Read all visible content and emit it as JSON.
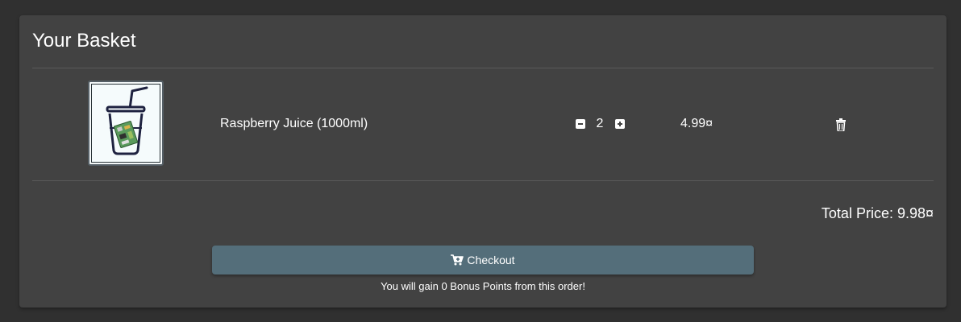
{
  "basket": {
    "title": "Your Basket",
    "items": [
      {
        "image_icon": "juice-cup-icon",
        "name": "Raspberry Juice (1000ml)",
        "quantity": "2",
        "price": "4.99¤"
      }
    ],
    "total_price": "Total Price: 9.98¤",
    "checkout_label": "Checkout",
    "bonus_message": "You will gain 0 Bonus Points from this order!"
  },
  "colors": {
    "background": "#303030",
    "card": "#424242",
    "checkout_button": "#546e7a"
  }
}
